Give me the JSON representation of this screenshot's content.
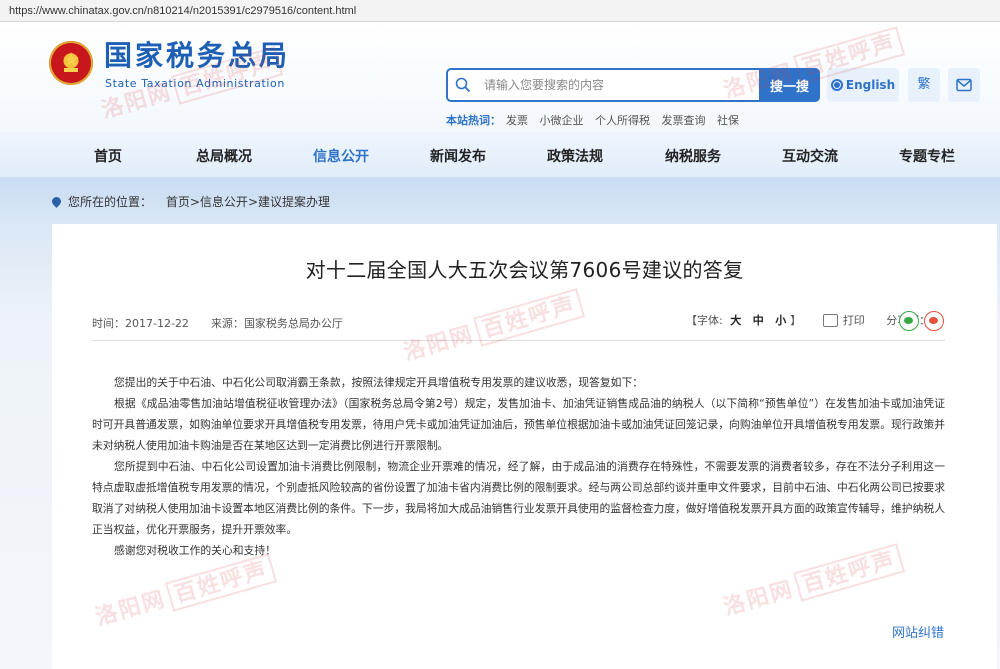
{
  "browser": {
    "url": "https://www.chinatax.gov.cn/n810214/n2015391/c2979516/content.html"
  },
  "header": {
    "logo_cn": "国家税务总局",
    "logo_en": "State Taxation Administration",
    "search_placeholder": "请输入您要搜索的内容",
    "search_button": "搜一搜",
    "hot_label": "本站热词：",
    "hot_words": [
      "发票",
      "小微企业",
      "个人所得税",
      "发票查询",
      "社保"
    ],
    "english_button": "English",
    "traditional_button": "繁"
  },
  "nav": {
    "items": [
      "首页",
      "总局概况",
      "信息公开",
      "新闻发布",
      "政策法规",
      "纳税服务",
      "互动交流",
      "专题专栏"
    ],
    "active": "信息公开"
  },
  "breadcrumb": {
    "prefix": "您所在的位置：",
    "items": [
      "首页",
      "信息公开",
      "建议提案办理"
    ],
    "separator": ">"
  },
  "article": {
    "title": "对十二届全国人大五次会议第7606号建议的答复",
    "time_label": "时间：",
    "time": "2017-12-22",
    "source_label": "来源：",
    "source": "国家税务总局办公厅",
    "font_label": "【字体:",
    "font_sizes": [
      "大",
      "中",
      "小"
    ],
    "font_close": "】",
    "print_label": "打印",
    "share_label": "分享到：",
    "paragraphs": [
      "您提出的关于中石油、中石化公司取消霸王条款，按照法律规定开具增值税专用发票的建议收悉，现答复如下：",
      "根据《成品油零售加油站增值税征收管理办法》（国家税务总局令第2号）规定，发售加油卡、加油凭证销售成品油的纳税人（以下简称“预售单位”）在发售加油卡或加油凭证时可开具普通发票，如购油单位要求开具增值税专用发票，待用户凭卡或加油凭证加油后，预售单位根据加油卡或加油凭证回笼记录，向购油单位开具增值税专用发票。现行政策并未对纳税人使用加油卡购油是否在某地区达到一定消费比例进行开票限制。",
      "您所提到中石油、中石化公司设置加油卡消费比例限制，物流企业开票难的情况，经了解，由于成品油的消费存在特殊性，不需要发票的消费者较多，存在不法分子利用这一特点虚取虚抵增值税专用发票的情况，个别虚抵风险较高的省份设置了加油卡省内消费比例的限制要求。经与两公司总部约谈并重申文件要求，目前中石油、中石化两公司已按要求取消了对纳税人使用加油卡设置本地区消费比例的条件。下一步，我局将加大成品油销售行业发票开具使用的监督检查力度，做好增值税发票开具方面的政策宣传辅导，维护纳税人正当权益，优化开票服务，提升开票效率。",
      "感谢您对税收工作的关心和支持！"
    ],
    "correction_link": "网站纠错"
  },
  "watermark": {
    "text": "洛阳网",
    "boxed": "百姓呼声"
  },
  "colors": {
    "brand_blue": "#2e73c9",
    "logo_blue": "#1d5fb4",
    "emblem_red": "#c8161d"
  }
}
